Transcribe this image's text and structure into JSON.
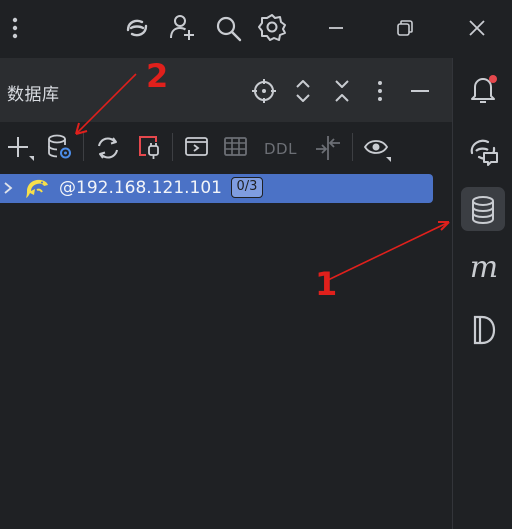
{
  "panel": {
    "title": "数据库"
  },
  "toolbar": {
    "ddl_label": "DDL"
  },
  "tree": {
    "connection_label": "@192.168.121.101",
    "badge": "0/3"
  },
  "right_sidebar": {
    "m_icon_label": "m"
  },
  "annotations": {
    "one": "1",
    "two": "2"
  },
  "colors": {
    "selection": "#4b72c6",
    "annotation": "#e0201c",
    "notification_dot": "#e5484d",
    "highlight": "#f7e04b"
  },
  "icons": [
    "more-vert-icon",
    "refresh-cloud-icon",
    "add-user-icon",
    "search-icon",
    "gear-icon",
    "minimize-icon",
    "restore-icon",
    "close-icon",
    "crosshair-icon",
    "expand-icon",
    "collapse-icon",
    "more-icon",
    "hide-icon",
    "add-icon",
    "db-config-icon",
    "sync-icon",
    "disconnect-icon",
    "console-icon",
    "table-icon",
    "ddl-icon",
    "compare-icon",
    "eye-icon",
    "chevron-right-icon",
    "dolphin-icon",
    "bell-icon",
    "ai-chat-icon",
    "database-icon",
    "mybatis-icon",
    "d-icon"
  ]
}
